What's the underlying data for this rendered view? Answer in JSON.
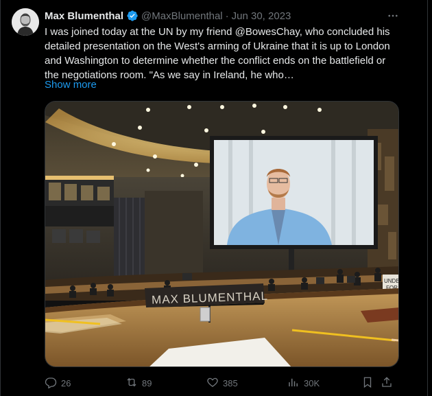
{
  "tweet": {
    "author_name": "Max Blumenthal",
    "handle": "@MaxBlumenthal",
    "separator": "·",
    "date": "Jun 30, 2023",
    "text": "I was joined today at the UN by my friend @BowesChay, who concluded his detailed presentation on the West's arming of Ukraine that it is up to London and Washington to determine whether the conflict ends on the battlefield or the negotiations room. \"As we say in Ireland, he who…",
    "show_more": "Show more",
    "more_icon": "more-horizontal-icon",
    "verified_icon": "verified-badge-icon",
    "accent_color": "#1d9bf0"
  },
  "media": {
    "placard_text": "MAX BLUMENTHAL",
    "side_sign_line1": "UNDER",
    "side_sign_line2": "FOR"
  },
  "actions": {
    "replies": "26",
    "reposts": "89",
    "likes": "385",
    "views": "30K",
    "icons": [
      "reply-icon",
      "repost-icon",
      "like-icon",
      "views-icon",
      "bookmark-icon",
      "share-icon"
    ]
  }
}
